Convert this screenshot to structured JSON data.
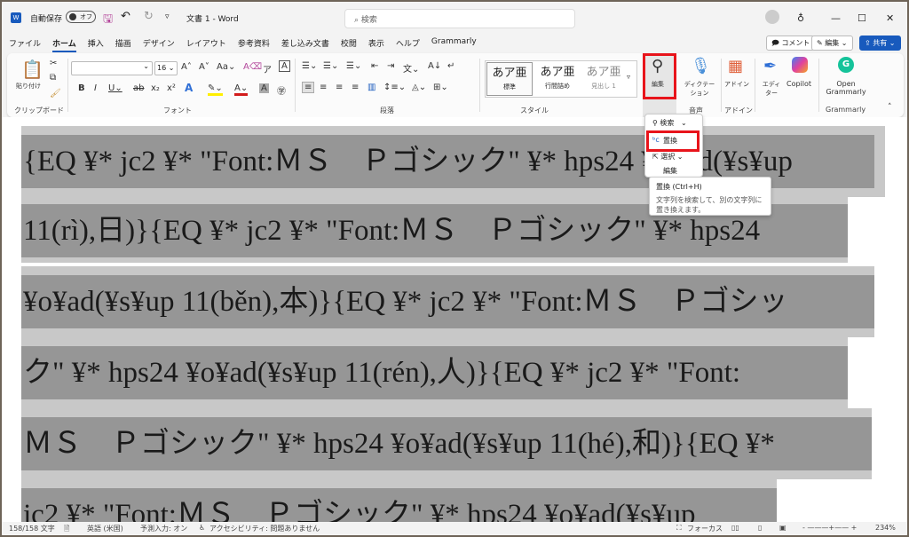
{
  "titlebar": {
    "autosave": "自動保存",
    "toggle": "オフ",
    "title": "文書 1 - Word",
    "search_placeholder": "検索"
  },
  "tabs": [
    "ファイル",
    "ホーム",
    "挿入",
    "描画",
    "デザイン",
    "レイアウト",
    "参考資料",
    "差し込み文書",
    "校閲",
    "表示",
    "ヘルプ",
    "Grammarly"
  ],
  "actions": {
    "comment": "コメント",
    "edit": "編集",
    "share": "共有"
  },
  "ribbon": {
    "clipboard": {
      "paste": "貼り付け",
      "label": "クリップボード"
    },
    "font": {
      "size": "16",
      "label": "フォント"
    },
    "paragraph": {
      "label": "段落"
    },
    "styles": {
      "items": [
        {
          "preview": "あア亜",
          "name": "標準"
        },
        {
          "preview": "あア亜",
          "name": "行間詰め"
        },
        {
          "preview": "あア亜",
          "name": "見出し 1"
        }
      ],
      "label": "スタイル"
    },
    "editing": {
      "label": "編集"
    },
    "voice": {
      "dictation": "ディクテーション",
      "label": "音声"
    },
    "addins": {
      "button": "アドイン",
      "label": "アドイン"
    },
    "editor": "エディター",
    "copilot": "Copilot",
    "grammarly": {
      "open": "Open Grammarly",
      "label": "Grammarly"
    }
  },
  "edit_menu": {
    "find": "検索",
    "replace": "置換",
    "select": "選択",
    "group": "編集"
  },
  "tooltip": {
    "title": "置換 (Ctrl+H)",
    "body": "文字列を検索して、別の文字列に置き換えます。"
  },
  "document": {
    "lines": [
      "{EQ ¥* jc2 ¥* \"Font:ＭＳ　Ｐゴシック\" ¥* hps24 ¥o¥ad(¥s¥up",
      "11(rì),日)}{EQ ¥* jc2 ¥* \"Font:ＭＳ　Ｐゴシック\" ¥* hps24",
      "¥o¥ad(¥s¥up 11(běn),本)}{EQ ¥* jc2 ¥* \"Font:ＭＳ　Ｐゴシッ",
      "ク\" ¥* hps24 ¥o¥ad(¥s¥up 11(rén),人)}{EQ ¥* jc2 ¥* \"Font:",
      "ＭＳ　Ｐゴシック\" ¥* hps24 ¥o¥ad(¥s¥up 11(hé),和)}{EQ ¥*",
      "jc2 ¥* \"Font:ＭＳ　Ｐゴシック\" ¥* hps24 ¥o¥ad(¥s¥up"
    ]
  },
  "status": {
    "words": "158/158 文字",
    "language": "英語 (米国)",
    "predict": "予測入力: オン",
    "accessibility": "アクセシビリティ: 問題ありません",
    "focus": "フォーカス",
    "zoom": "234%"
  },
  "colors": {
    "accent": "#185abd",
    "highlight": "#e8141b",
    "field_dark": "#969696",
    "field_light": "#c8c8c8"
  }
}
